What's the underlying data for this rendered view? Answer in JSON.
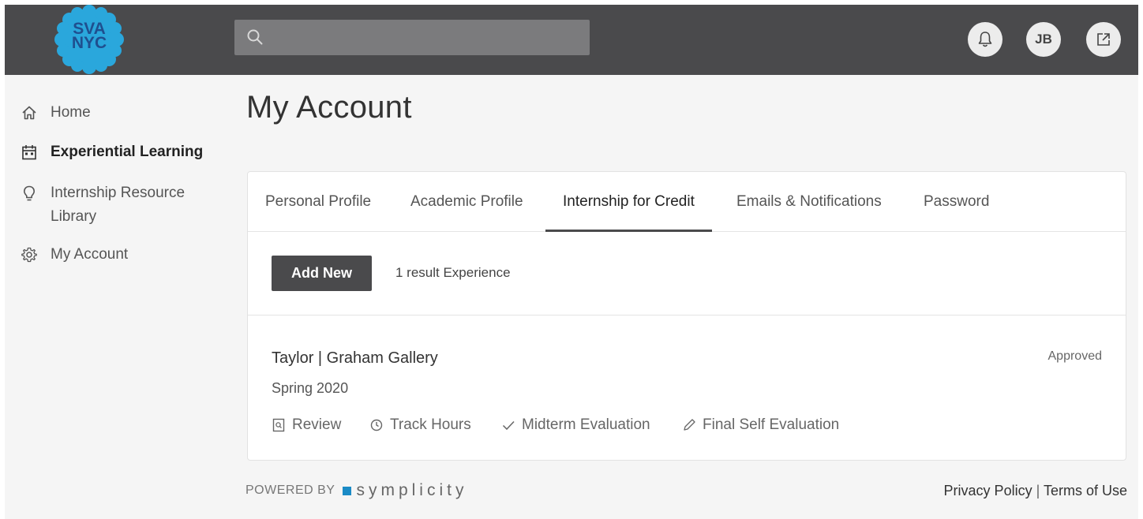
{
  "header": {
    "logo_text_line1": "SVA",
    "logo_text_line2": "NYC",
    "search_placeholder": "",
    "notifications_icon": "bell-icon",
    "avatar_initials": "JB",
    "external_icon": "external-link-icon"
  },
  "sidebar": {
    "items": [
      {
        "label": "Home",
        "icon": "home-icon"
      },
      {
        "label": "Experiential Learning",
        "icon": "calendar-icon"
      },
      {
        "label": "Internship Resource",
        "label2": "Library",
        "icon": "lightbulb-icon"
      },
      {
        "label": "My Account",
        "icon": "gear-icon"
      }
    ]
  },
  "main": {
    "title": "My Account",
    "tabs": [
      {
        "label": "Personal Profile"
      },
      {
        "label": "Academic Profile"
      },
      {
        "label": "Internship for Credit"
      },
      {
        "label": "Emails & Notifications"
      },
      {
        "label": "Password"
      }
    ],
    "add_new_label": "Add New",
    "result_count": "1 result Experience",
    "experience": {
      "title": "Taylor | Graham Gallery",
      "term": "Spring 2020",
      "status": "Approved",
      "actions": [
        {
          "label": "Review",
          "icon": "document-search-icon"
        },
        {
          "label": "Track Hours",
          "icon": "clock-icon"
        },
        {
          "label": "Midterm Evaluation",
          "icon": "checkmark-icon"
        },
        {
          "label": "Final Self Evaluation",
          "icon": "pencil-icon"
        }
      ]
    }
  },
  "footer": {
    "powered_by": "POWERED BY",
    "brand": "symplicity",
    "privacy": "Privacy Policy",
    "separator": "|",
    "terms": "Terms of Use"
  },
  "colors": {
    "topbar": "#4a4a4c",
    "logo_blue": "#2aa7dc",
    "symplicity_blue": "#1b8bc6"
  }
}
